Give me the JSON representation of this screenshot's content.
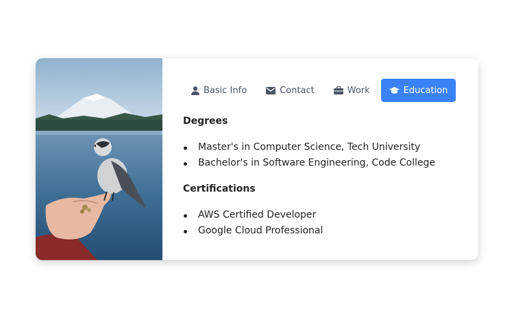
{
  "tabs": [
    {
      "label": "Basic Info",
      "icon": "user-icon",
      "active": false
    },
    {
      "label": "Contact",
      "icon": "envelope-icon",
      "active": false
    },
    {
      "label": "Work",
      "icon": "briefcase-icon",
      "active": false
    },
    {
      "label": "Education",
      "icon": "graduation-cap-icon",
      "active": true
    }
  ],
  "colors": {
    "accent": "#3b82f6",
    "tab_text": "#4b5563"
  },
  "education": {
    "degrees_title": "Degrees",
    "degrees": [
      "Master's in Computer Science, Tech University",
      "Bachelor's in Software Engineering, Code College"
    ],
    "certifications_title": "Certifications",
    "certifications": [
      "AWS Certified Developer",
      "Google Cloud Professional"
    ]
  }
}
